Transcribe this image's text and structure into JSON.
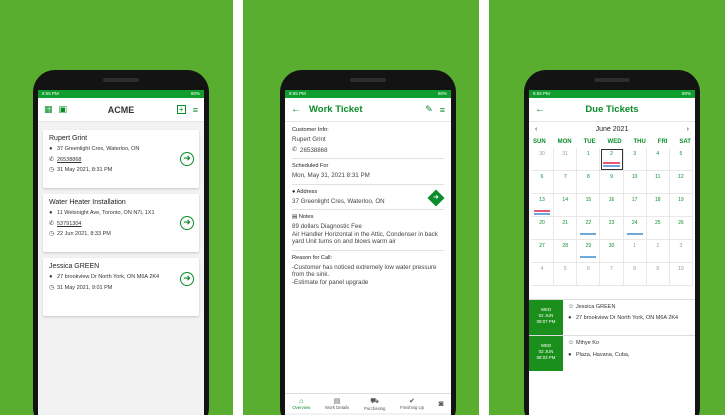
{
  "status": {
    "time": "8:55 PM",
    "net": "0.9KB/s",
    "battery": "80%"
  },
  "screen1": {
    "brand": "ACME",
    "tickets": [
      {
        "name": "Rupert Grint",
        "address": "37 Greenlight Cres, Waterloo, ON",
        "phone": "26538868",
        "date": "31 May 2021, 8:31 PM"
      },
      {
        "name": "Water Heater Installation",
        "address": "11 Wetsnight Ave, Toronto, ON N7L 1X1",
        "phone": "53791304",
        "date": "22 Jun 2021, 8:33 PM"
      },
      {
        "name": "Jessica GREEN",
        "address": "27 brookview Dr North York, ON M6A 2K4",
        "date": "31 May 2021, 9:01 PM"
      }
    ]
  },
  "screen2": {
    "title": "Work Ticket",
    "customer_label": "Customer Info:",
    "customer": "Rupert Grint",
    "phone": "26538868",
    "scheduled_label": "Scheduled For",
    "scheduled": "Mon, May 31, 2021  8:31 PM",
    "address_label": "Address",
    "address": "37 Greenlight Cres, Waterloo, ON",
    "notes_label": "Notes",
    "notes": "89 dollars Diagnostic Fee\nAir Handler Horizontal in the Attic, Condenser in back yard Unit turns on and blows warm air",
    "reason_label": "Reason for Call:",
    "reason": "-Customer has noticed extremely low water pressure from the sink.\n-Estimate for panel upgrade",
    "tabs": [
      "Overview",
      "Work Details",
      "Purchasing",
      "Finishing Up"
    ]
  },
  "screen3": {
    "title": "Due Tickets",
    "month": "June 2021",
    "weekdays": [
      "SUN",
      "MON",
      "TUE",
      "WED",
      "THU",
      "FRI",
      "SAT"
    ],
    "days": [
      "30",
      "31",
      "1",
      "2",
      "3",
      "4",
      "5",
      "6",
      "7",
      "8",
      "9",
      "10",
      "11",
      "12",
      "13",
      "14",
      "15",
      "16",
      "17",
      "18",
      "19",
      "20",
      "21",
      "22",
      "23",
      "24",
      "25",
      "26",
      "27",
      "28",
      "29",
      "30",
      "1",
      "2",
      "3",
      "4",
      "5",
      "6",
      "7",
      "8",
      "9",
      "10"
    ],
    "due": [
      {
        "day": "WED",
        "date": "02 JUN",
        "time": "08:07 PM",
        "name": "Jessica GREEN",
        "address": "27 brookview Dr North York, ON M6A 2K4"
      },
      {
        "day": "WED",
        "date": "02 JUN",
        "time": "08:03 PM",
        "name": "Mihye Ko",
        "address": "Plaza, Havana, Cuba,"
      }
    ]
  }
}
